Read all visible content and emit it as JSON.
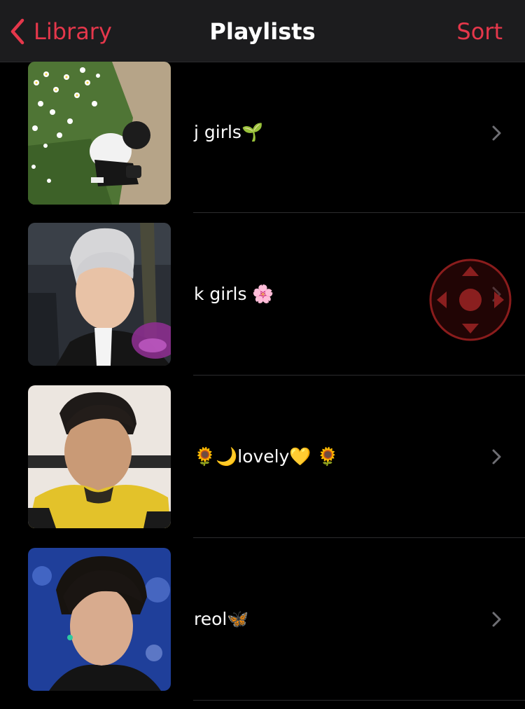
{
  "nav": {
    "back_label": "Library",
    "title": "Playlists",
    "sort_label": "Sort",
    "accent_color": "#e5374b"
  },
  "playlists": [
    {
      "title": "j girls🌱"
    },
    {
      "title": "k girls 🌸"
    },
    {
      "title": "🌻🌙lovely💛 🌻"
    },
    {
      "title": "reol🦋"
    }
  ],
  "icons": {
    "back": "chevron-left-icon",
    "row_disclosure": "chevron-right-icon",
    "overlay": "dpad-control-icon"
  }
}
